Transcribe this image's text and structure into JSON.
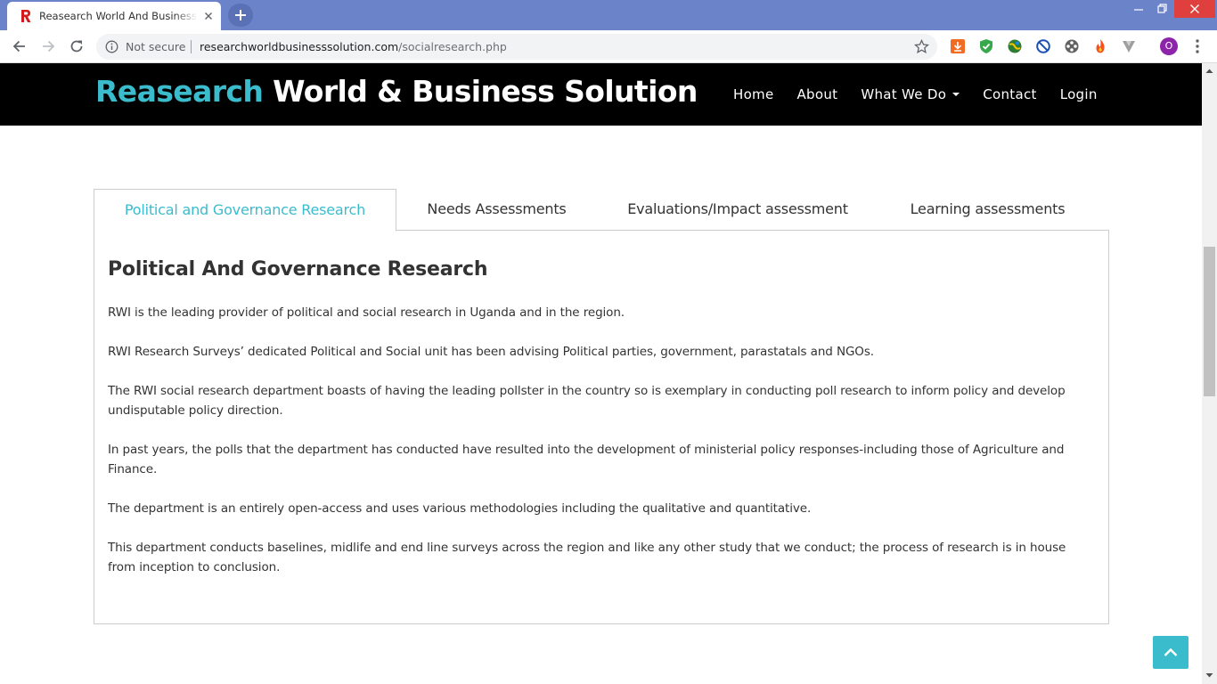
{
  "browser": {
    "tab_title": "Reasearch World And Business Solution",
    "not_secure_label": "Not secure",
    "url_domain": "researchworldbusinesssolution.com",
    "url_path": "/socialresearch.php",
    "profile_initial": "O"
  },
  "site": {
    "brand_accent": "Reasearch",
    "brand_rest": " World & Business Solution",
    "nav": [
      {
        "label": "Home"
      },
      {
        "label": "About"
      },
      {
        "label": "What We Do"
      },
      {
        "label": "Contact"
      },
      {
        "label": "Login"
      }
    ]
  },
  "tabs": [
    {
      "label": "Political and Governance Research",
      "active": true
    },
    {
      "label": "Needs Assessments",
      "active": false
    },
    {
      "label": "Evaluations/Impact assessment",
      "active": false
    },
    {
      "label": "Learning assessments",
      "active": false
    }
  ],
  "content": {
    "heading": "Political And Governance Research",
    "paragraphs": [
      "RWI is the leading provider of political and social research in Uganda and in the region.",
      "RWI Research Surveys’ dedicated Political and Social unit has been advising Political parties, government, parastatals and NGOs.",
      "The RWI social research department boasts of having the leading pollster in the country so is exemplary in conducting poll research to inform policy and develop undisputable policy direction.",
      "In past years, the polls that the department has conducted have resulted into the development of ministerial policy responses-including those of Agriculture and Finance.",
      "The department is an entirely open-access and uses various methodologies including the qualitative and quantitative.",
      "This department conducts baselines, midlife and end line surveys across the region and like any other study that we conduct; the process of research is in house from inception to conclusion."
    ]
  },
  "colors": {
    "accent": "#3bbccd",
    "navbar_bg": "#000000",
    "chrome_frame": "#6b83c9",
    "profile": "#8e24aa"
  },
  "icons": [
    "back-arrow-icon",
    "forward-arrow-icon",
    "reload-icon",
    "info-icon",
    "star-icon",
    "extension-icons",
    "menu-dots-icon",
    "chevron-up-icon"
  ]
}
